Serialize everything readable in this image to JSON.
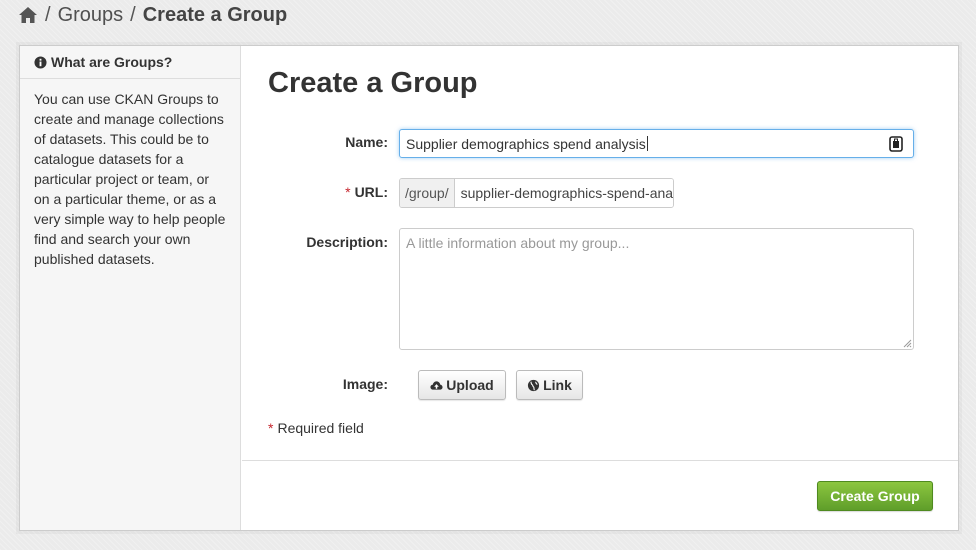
{
  "breadcrumb": {
    "home_icon": "home-icon",
    "items": [
      "Groups",
      "Create a Group"
    ],
    "separator": "/"
  },
  "sidebar": {
    "heading": "What are Groups?",
    "heading_icon": "info-circle-icon",
    "body": "You can use CKAN Groups to create and manage collections of datasets. This could be to catalogue datasets for a particular project or team, or on a particular theme, or as a very simple way to help people find and search your own published datasets."
  },
  "form": {
    "title": "Create a Group",
    "name_label": "Name:",
    "name_value": "Supplier demographics spend analysis",
    "url_required_marker": "*",
    "url_label": "URL:",
    "url_prefix": "/group/",
    "url_value": "supplier-demographics-spend-analysis",
    "description_label": "Description:",
    "description_placeholder": "A little information about my group...",
    "image_label": "Image:",
    "upload_label": "Upload",
    "link_label": "Link",
    "required_marker": "*",
    "required_note": "Required field",
    "submit_label": "Create Group"
  },
  "colors": {
    "accent_green": "#6fb32e",
    "required_red": "#c6262e",
    "focus_blue": "#66afe9"
  }
}
